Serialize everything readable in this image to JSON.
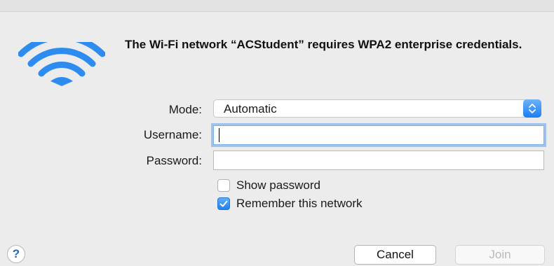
{
  "dialog": {
    "title": "The Wi-Fi network “ACStudent” requires WPA2 enterprise credentials."
  },
  "form": {
    "mode_label": "Mode:",
    "mode_value": "Automatic",
    "username_label": "Username:",
    "username_value": "",
    "password_label": "Password:",
    "password_value": "",
    "show_password_label": "Show password",
    "show_password_checked": false,
    "remember_label": "Remember this network",
    "remember_checked": true
  },
  "buttons": {
    "help": "?",
    "cancel": "Cancel",
    "join": "Join"
  },
  "colors": {
    "accent": "#1d80f2",
    "wifi_icon": "#2e8cf0"
  }
}
